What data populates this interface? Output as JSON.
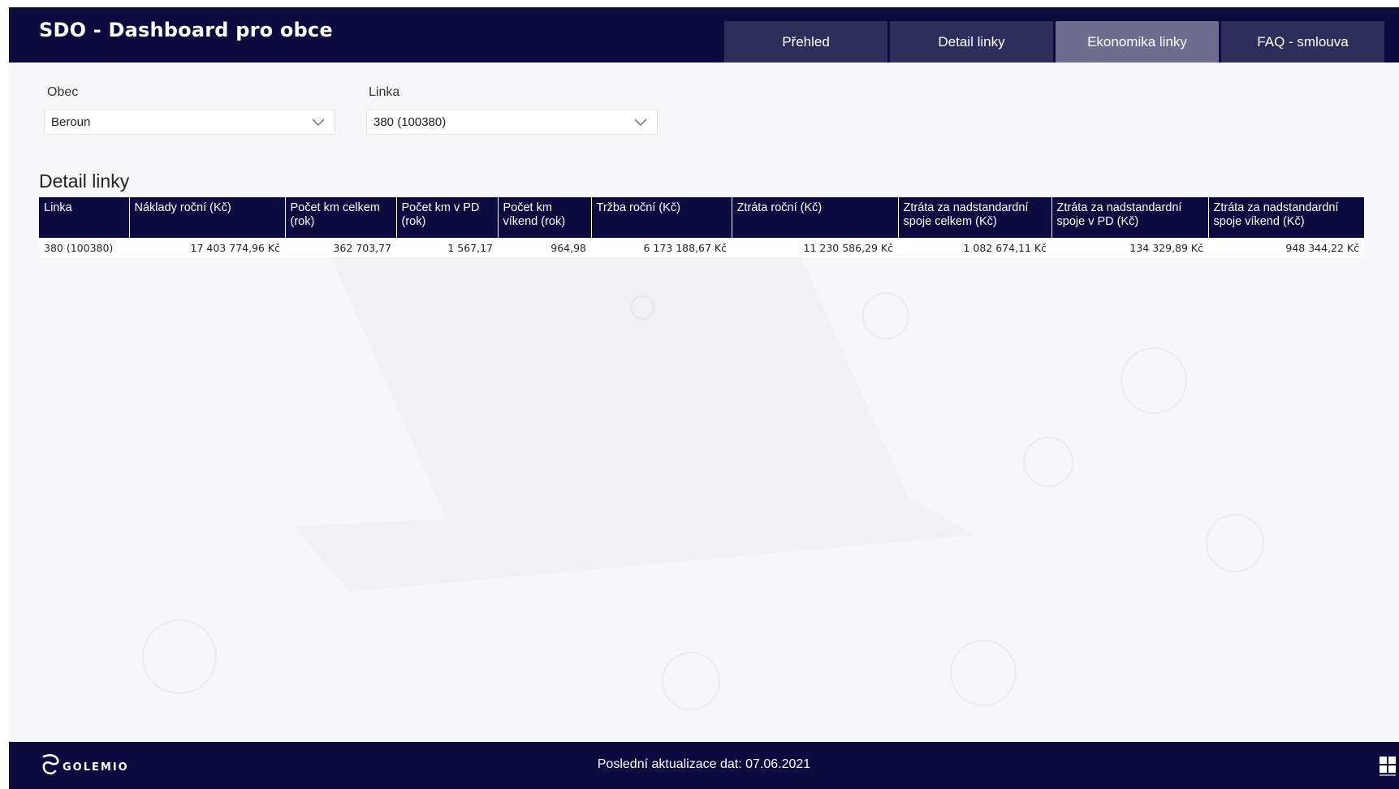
{
  "app": {
    "title": "SDO - Dashboard pro obce"
  },
  "tabs": [
    {
      "label": "Přehled",
      "active": false
    },
    {
      "label": "Detail linky",
      "active": false
    },
    {
      "label": "Ekonomika linky",
      "active": true
    },
    {
      "label": "FAQ - smlouva",
      "active": false
    }
  ],
  "filters": {
    "obec": {
      "label": "Obec",
      "value": "Beroun"
    },
    "linka": {
      "label": "Linka",
      "value": "380 (100380)"
    }
  },
  "section": {
    "title": "Detail linky"
  },
  "table": {
    "headers": [
      "Linka",
      "Náklady roční (Kč)",
      "Počet km celkem (rok)",
      "Počet km v PD (rok)",
      "Počet km víkend (rok)",
      "Tržba roční (Kč)",
      "Ztráta roční (Kč)",
      "Ztráta za nadstandardní spoje celkem (Kč)",
      "Ztráta za nadstandardní spoje v PD (Kč)",
      "Ztráta za nadstandardní spoje víkend (Kč)"
    ],
    "rows": [
      [
        "380 (100380)",
        "17 403 774,96 Kč",
        "362 703,77",
        "1 567,17",
        "964,98",
        "6 173 188,67 Kč",
        "11 230 586,29 Kč",
        "1 082 674,11 Kč",
        "134 329,89 Kč",
        "948 344,22 Kč"
      ]
    ]
  },
  "footer": {
    "last_update": "Poslední aktualizace dat: 07.06.2021",
    "logo_text": "GOLEMIO",
    "logo_icon": "golemio-logo-icon",
    "right_logo": "oict-logo"
  },
  "colors": {
    "header_bg": "#0b0b3f",
    "tab_bg": "#2e2e5a",
    "tab_active_bg": "#6e6d8f",
    "page_bg": "#f7f6f9"
  }
}
